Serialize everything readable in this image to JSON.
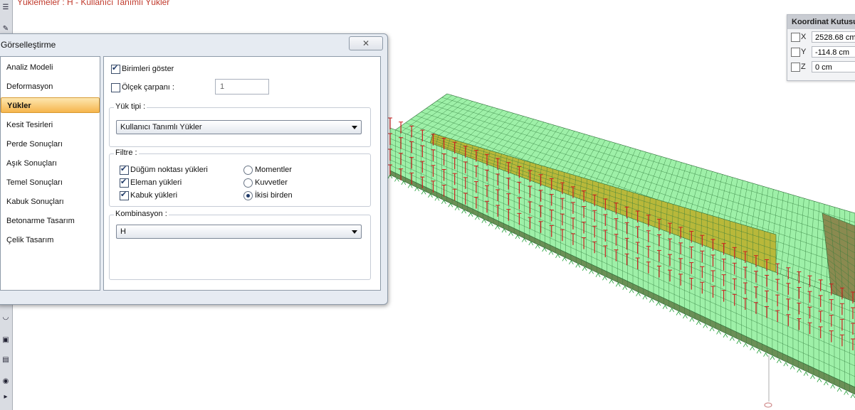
{
  "header": {
    "text": "Yüklemeler : H - Kullanıcı Tanımlı Yükler"
  },
  "coordinate_box": {
    "title": "Koordinat Kutusu",
    "rows": [
      {
        "axis": "X",
        "value": "2528.68 cm"
      },
      {
        "axis": "Y",
        "value": "-114.8 cm"
      },
      {
        "axis": "Z",
        "value": "0 cm"
      }
    ]
  },
  "dialog": {
    "title": "Görselleştirme",
    "nav": [
      "Analiz Modeli",
      "Deformasyon",
      "Yükler",
      "Kesit Tesirleri",
      "Perde Sonuçları",
      "Aşık Sonuçları",
      "Temel Sonuçları",
      "Kabuk Sonuçları",
      "Betonarme Tasarım",
      "Çelik Tasarım"
    ],
    "selected_nav": "Yükler",
    "show_units": {
      "label": "Birimleri göster",
      "checked": true
    },
    "scale_factor": {
      "label": "Ölçek çarpanı :",
      "checked": false,
      "placeholder": "1"
    },
    "load_type": {
      "label": "Yük tipi :",
      "value": "Kullanıcı Tanımlı Yükler"
    },
    "filter": {
      "label": "Filtre :",
      "checkboxes": [
        {
          "label": "Düğüm noktası yükleri",
          "checked": true
        },
        {
          "label": "Eleman yükleri",
          "checked": true
        },
        {
          "label": "Kabuk yükleri",
          "checked": true
        }
      ],
      "radios": [
        {
          "label": "Momentler",
          "checked": false
        },
        {
          "label": "Kuvvetler",
          "checked": false
        },
        {
          "label": "İkisi birden",
          "checked": true
        }
      ]
    },
    "combination": {
      "label": "Kombinasyon :",
      "value": "H"
    }
  },
  "colors": {
    "mesh_green": "#9ef0a8",
    "mesh_inner": "#b8b83a",
    "load_arrow": "#cc1f1f",
    "support": "#1e9e35",
    "header_text": "#c0392b",
    "selection_orange": "#f6b54c"
  }
}
